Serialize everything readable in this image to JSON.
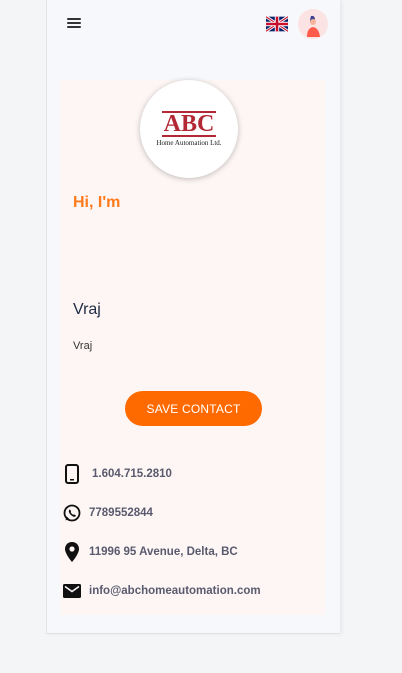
{
  "header": {
    "menu_icon": "hamburger-menu-icon",
    "language_flag": "uk-flag-icon",
    "avatar_icon": "user-avatar-icon"
  },
  "profile": {
    "logo": {
      "main": "ABC",
      "sub": "Home Automation Ltd."
    },
    "greeting": "Hi, I'm",
    "name": "Vraj",
    "subtitle": "Vraj",
    "save_button": "SAVE CONTACT"
  },
  "contacts": [
    {
      "icon": "mobile-phone-icon",
      "text": "1.604.715.2810"
    },
    {
      "icon": "whatsapp-icon",
      "text": "7789552844"
    },
    {
      "icon": "location-pin-icon",
      "text": "11996 95 Avenue, Delta, BC"
    },
    {
      "icon": "email-icon",
      "text": "info@abchomeautomation.com"
    }
  ],
  "colors": {
    "accent": "#ff6a00",
    "greeting": "#ff7a1a",
    "card_bg": "#fdf6f5",
    "name_text": "#1f2a44",
    "brand_red": "#b32835"
  }
}
